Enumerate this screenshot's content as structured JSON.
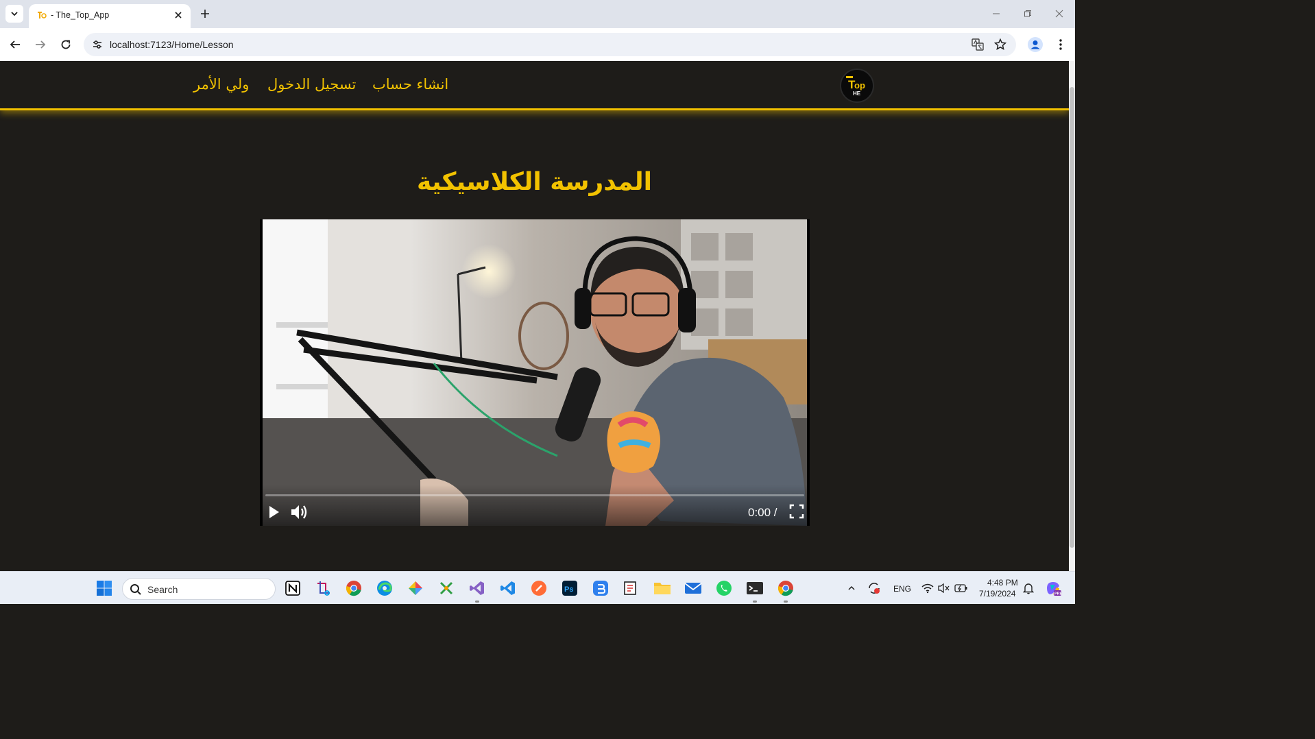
{
  "browser": {
    "tab": {
      "title": "- The_Top_App"
    },
    "url": "localhost:7123/Home/Lesson"
  },
  "site": {
    "nav": {
      "create_account": "انشاء حساب",
      "login": "تسجيل الدخول",
      "guardian": "ولي الأمر"
    },
    "logo": {
      "top": "T",
      "main": "op",
      "sub": "HE"
    }
  },
  "lesson": {
    "title": "المدرسة الكلاسيكية",
    "video": {
      "time": "0:00 /",
      "progress": 0
    }
  },
  "taskbar": {
    "search_label": "Search",
    "language": "ENG",
    "time": "4:48 PM",
    "date": "7/19/2024"
  },
  "colors": {
    "accent": "#f2c200",
    "page_bg": "#1e1c19"
  }
}
